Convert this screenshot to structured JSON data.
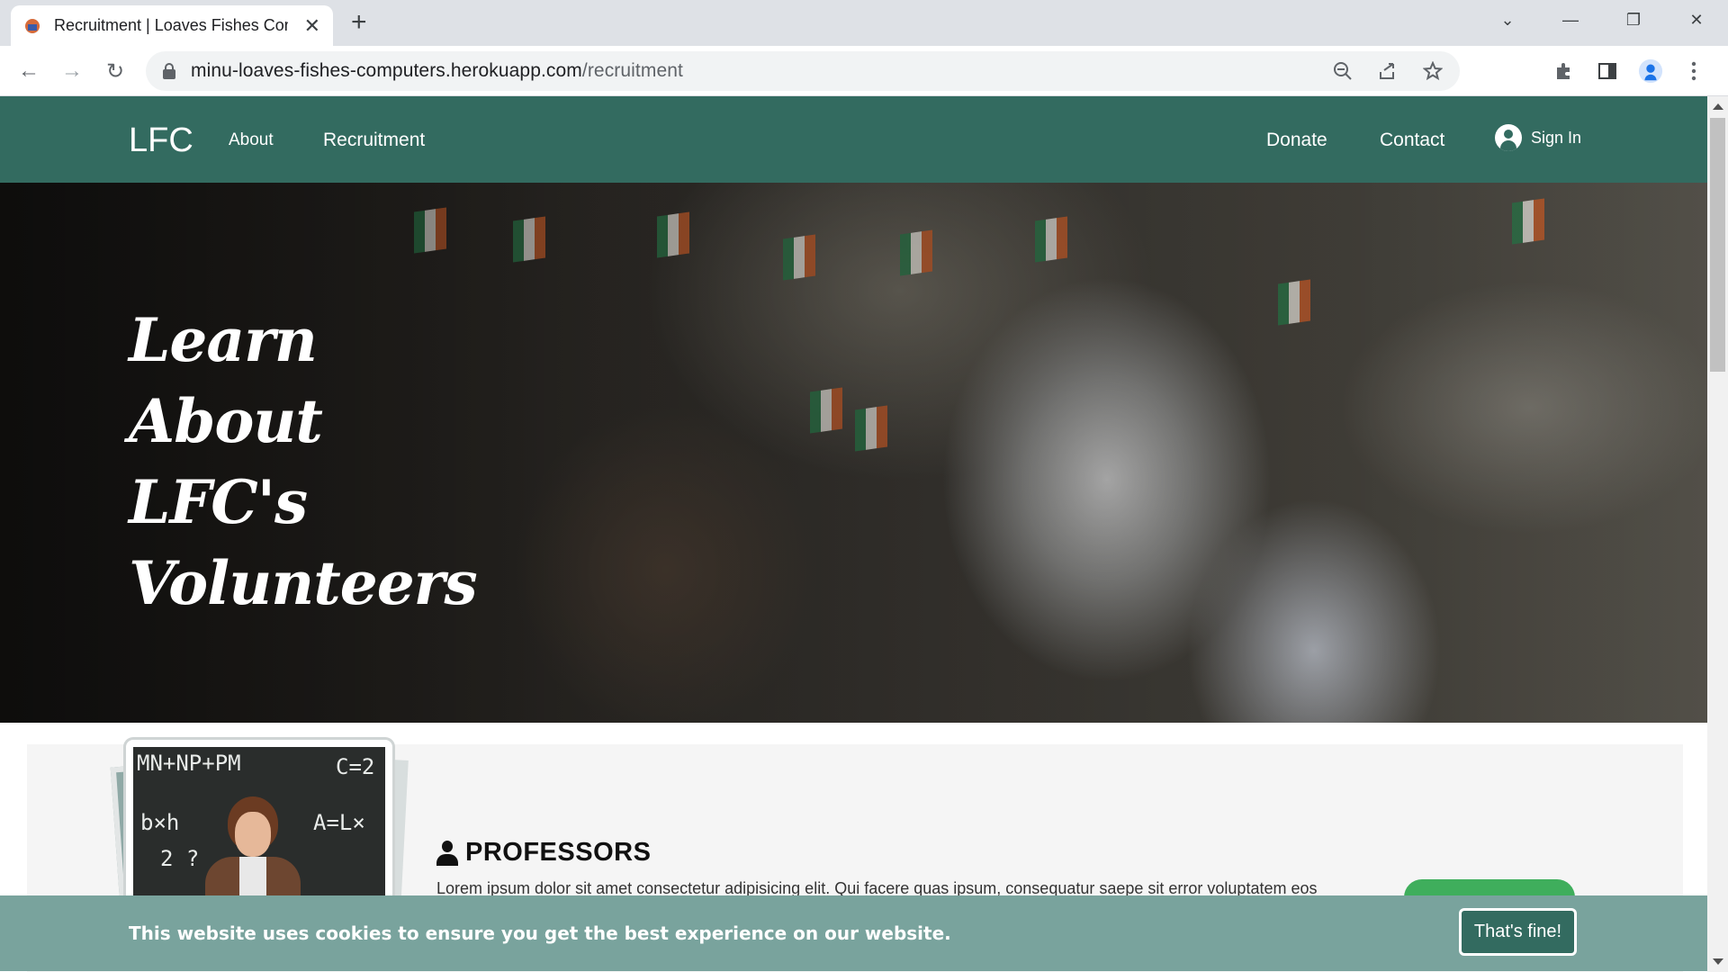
{
  "browser": {
    "tab_title": "Recruitment | Loaves Fishes Computers",
    "url_domain": "minu-loaves-fishes-computers.herokuapp.com",
    "url_path": "/recruitment",
    "new_tab": "+",
    "close": "✕"
  },
  "nav": {
    "brand": "LFC",
    "about": "About",
    "recruitment": "Recruitment",
    "donate": "Donate",
    "contact": "Contact",
    "sign_in": "Sign In"
  },
  "hero": {
    "lines": [
      "Learn",
      "About",
      "LFC's",
      "Volunteers"
    ]
  },
  "section": {
    "title": "PROFESSORS",
    "text": "Lorem ipsum dolor sit amet consectetur adipisicing elit. Qui facere quas ipsum, consequatur saepe sit error voluptatem eos"
  },
  "cookie": {
    "message": "This website uses cookies to ensure you get the best experience on our website.",
    "button": "That's fine!"
  },
  "colors": {
    "brand_green": "#336b60",
    "cookie_bar": "#79a39d"
  }
}
